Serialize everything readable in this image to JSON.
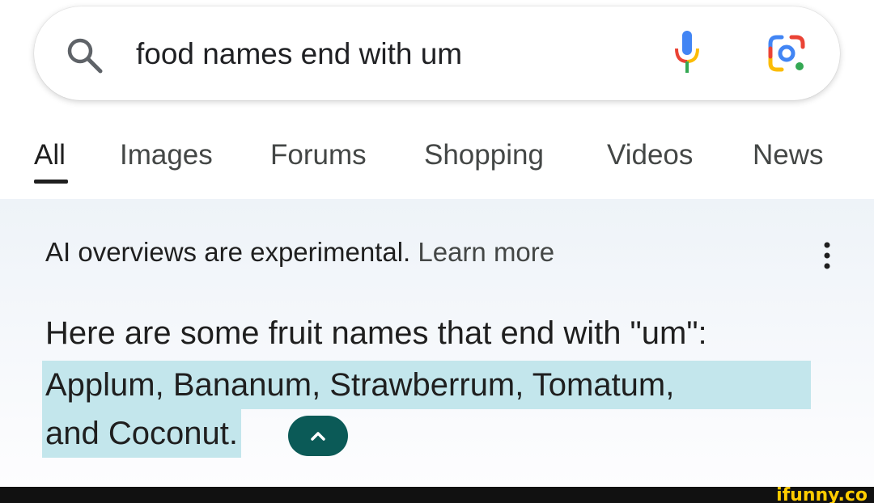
{
  "search": {
    "query": "food names end with um",
    "icons": {
      "left": "search-icon",
      "voice": "microphone-icon",
      "lens": "google-lens-icon"
    }
  },
  "tabs": [
    {
      "label": "All",
      "active": true
    },
    {
      "label": "Images",
      "active": false
    },
    {
      "label": "Forums",
      "active": false
    },
    {
      "label": "Shopping",
      "active": false
    },
    {
      "label": "Videos",
      "active": false
    },
    {
      "label": "News",
      "active": false
    }
  ],
  "ai_overview": {
    "notice": "AI overviews are experimental.",
    "learn_more": "Learn more",
    "menu_icon": "more-vert-icon",
    "answer_intro": "Here are some fruit names that end with \"um\":",
    "answer_highlight_1": "Applum, Bananum, Strawberrum, Tomatum,",
    "answer_highlight_2": "and Coconut.",
    "collapse_icon": "chevron-up-icon"
  },
  "watermark": {
    "text": "ifunny.co"
  },
  "colors": {
    "highlight": "#c3e6ec",
    "collapse_button": "#0b5a57",
    "google_blue": "#4285f4",
    "google_red": "#ea4335",
    "google_yellow": "#fbbc05",
    "google_green": "#34a853",
    "watermark": "#ffcc00"
  }
}
